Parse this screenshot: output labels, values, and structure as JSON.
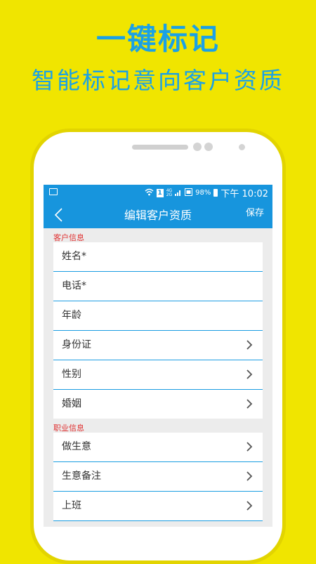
{
  "promo": {
    "title": "一键标记",
    "subtitle": "智能标记意向客户资质"
  },
  "status_bar": {
    "sim_slot": "1",
    "network_top": "4G",
    "network_bottom": "2G",
    "battery": "98%",
    "time": "下午 10:02"
  },
  "nav": {
    "title": "编辑客户资质",
    "save_label": "保存"
  },
  "sections": {
    "customer": {
      "label": "客户信息",
      "rows": [
        "姓名*",
        "电话*",
        "年龄",
        "身份证",
        "性别",
        "婚姻"
      ]
    },
    "career": {
      "label": "职业信息",
      "rows": [
        "做生意",
        "生意备注",
        "上班"
      ]
    }
  },
  "colors": {
    "background": "#f0e500",
    "accent": "#1795dd",
    "section_label": "#e03030"
  }
}
